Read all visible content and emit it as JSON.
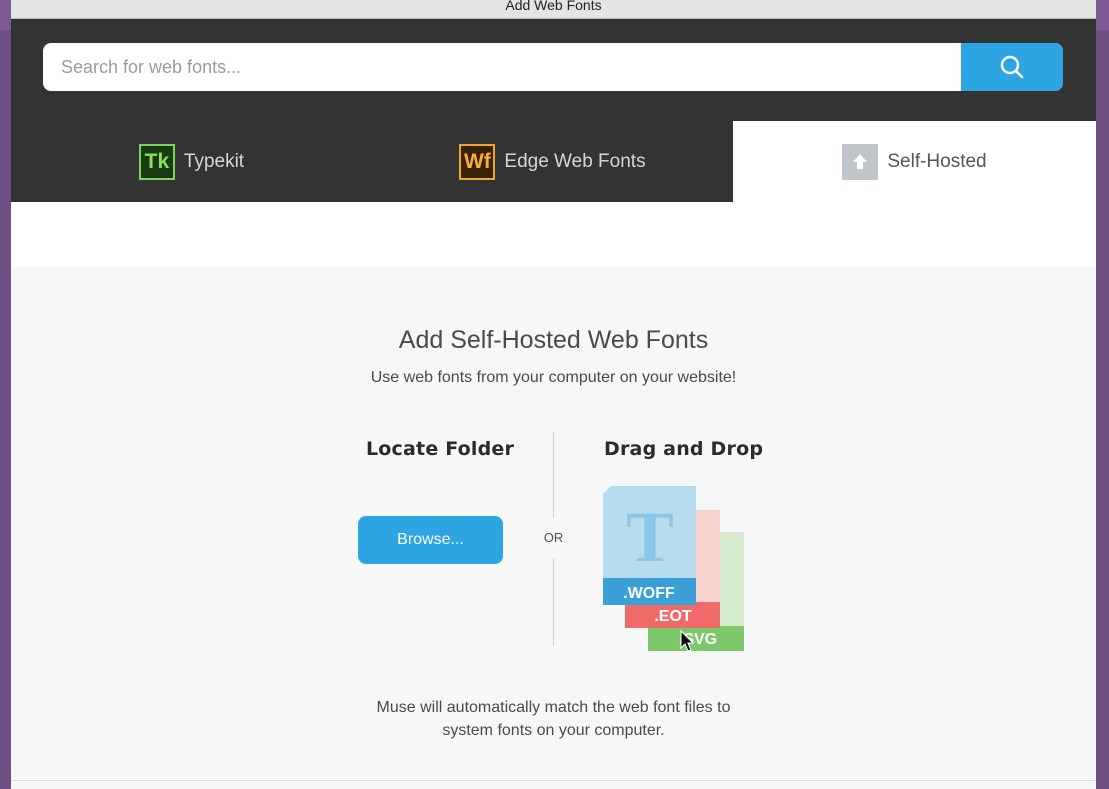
{
  "window": {
    "title": "Add Web Fonts"
  },
  "search": {
    "placeholder": "Search for web fonts..."
  },
  "tabs": [
    {
      "label": "Typekit",
      "logo": "Tk"
    },
    {
      "label": "Edge Web Fonts",
      "logo": "Wf"
    },
    {
      "label": "Self-Hosted",
      "logo": "upload-icon",
      "active": true
    }
  ],
  "content": {
    "heading": "Add Self-Hosted Web Fonts",
    "subheading": "Use web fonts from your computer on your website!",
    "locate_title": "Locate Folder",
    "browse_label": "Browse...",
    "or_label": "OR",
    "drag_title": "Drag and Drop",
    "file_types": [
      ".WOFF",
      ".EOT",
      ".SVG"
    ],
    "file_glyph": "T",
    "footnote_line1": "Muse will automatically match the web font files to",
    "footnote_line2": "system fonts on your computer."
  },
  "colors": {
    "accent": "#2da5e3",
    "dark_band": "#333333",
    "woff": "#3b9fd8",
    "eot": "#f06a6a",
    "svg": "#7cc86a"
  }
}
